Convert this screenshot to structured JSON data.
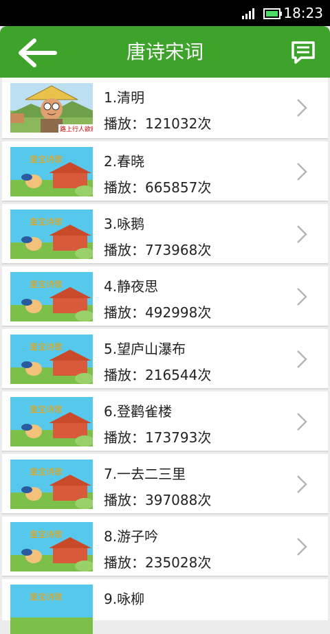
{
  "status": {
    "time": "18:23"
  },
  "header": {
    "title": "唐诗宋词"
  },
  "play_prefix": "播放：",
  "play_suffix": "次",
  "thumb_text": {
    "first": "路上行人欲断",
    "banner": "童宝诗歌"
  },
  "items": [
    {
      "title": "1.清明",
      "plays": "播放：121032次"
    },
    {
      "title": "2.春晓",
      "plays": "播放：665857次"
    },
    {
      "title": "3.咏鹅",
      "plays": "播放：773968次"
    },
    {
      "title": "4.静夜思",
      "plays": "播放：492998次"
    },
    {
      "title": "5.望庐山瀑布",
      "plays": "播放：216544次"
    },
    {
      "title": "6.登鹳雀楼",
      "plays": "播放：173793次"
    },
    {
      "title": "7.一去二三里",
      "plays": "播放：397088次"
    },
    {
      "title": "8.游子吟",
      "plays": "播放：235028次"
    },
    {
      "title": "9.咏柳",
      "plays": ""
    }
  ],
  "colors": {
    "header": "#3ea32b",
    "status_bar": "#000000",
    "battery": "#4cd964"
  }
}
